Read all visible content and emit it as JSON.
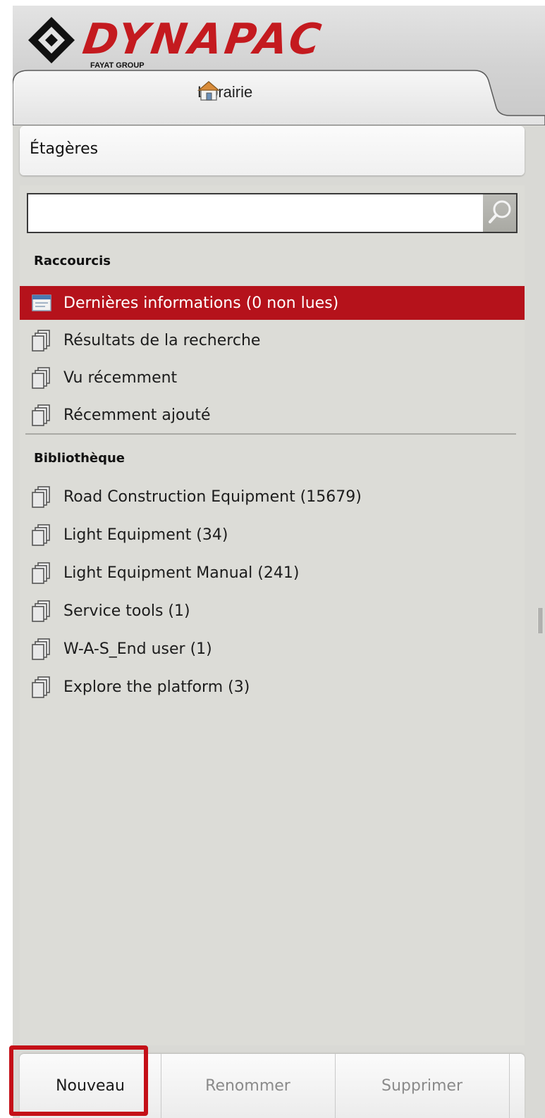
{
  "brand": {
    "logo_text": "DYNAPAC",
    "logo_subtext": "FAYAT GROUP",
    "brand_color": "#c41a1f"
  },
  "tab": {
    "label": "Librairie",
    "icon": "home-icon"
  },
  "shelves": {
    "title": "Étagères"
  },
  "search": {
    "placeholder": "",
    "value": "",
    "button_icon": "search-icon"
  },
  "shortcuts": {
    "title": "Raccourcis",
    "items": [
      {
        "label": "Dernières informations (0 non lues)",
        "icon": "news-icon",
        "active": true
      },
      {
        "label": "Résultats de la recherche",
        "icon": "book-stack-icon",
        "active": false
      },
      {
        "label": "Vu récemment",
        "icon": "book-stack-icon",
        "active": false
      },
      {
        "label": "Récemment ajouté",
        "icon": "book-stack-icon",
        "active": false
      }
    ]
  },
  "library": {
    "title": "Bibliothèque",
    "items": [
      {
        "label": "Road Construction Equipment (15679)",
        "icon": "book-stack-icon"
      },
      {
        "label": "Light Equipment (34)",
        "icon": "book-stack-icon"
      },
      {
        "label": "Light Equipment Manual (241)",
        "icon": "book-stack-icon"
      },
      {
        "label": "Service tools (1)",
        "icon": "book-stack-icon"
      },
      {
        "label": "W-A-S_End user (1)",
        "icon": "book-stack-icon"
      },
      {
        "label": "Explore the platform (3)",
        "icon": "book-stack-icon"
      }
    ]
  },
  "footer": {
    "new_label": "Nouveau",
    "rename_label": "Renommer",
    "delete_label": "Supprimer"
  },
  "colors": {
    "active_row": "#b5121b",
    "highlight_border": "#c41018",
    "panel_bg": "#dcdcd7"
  }
}
